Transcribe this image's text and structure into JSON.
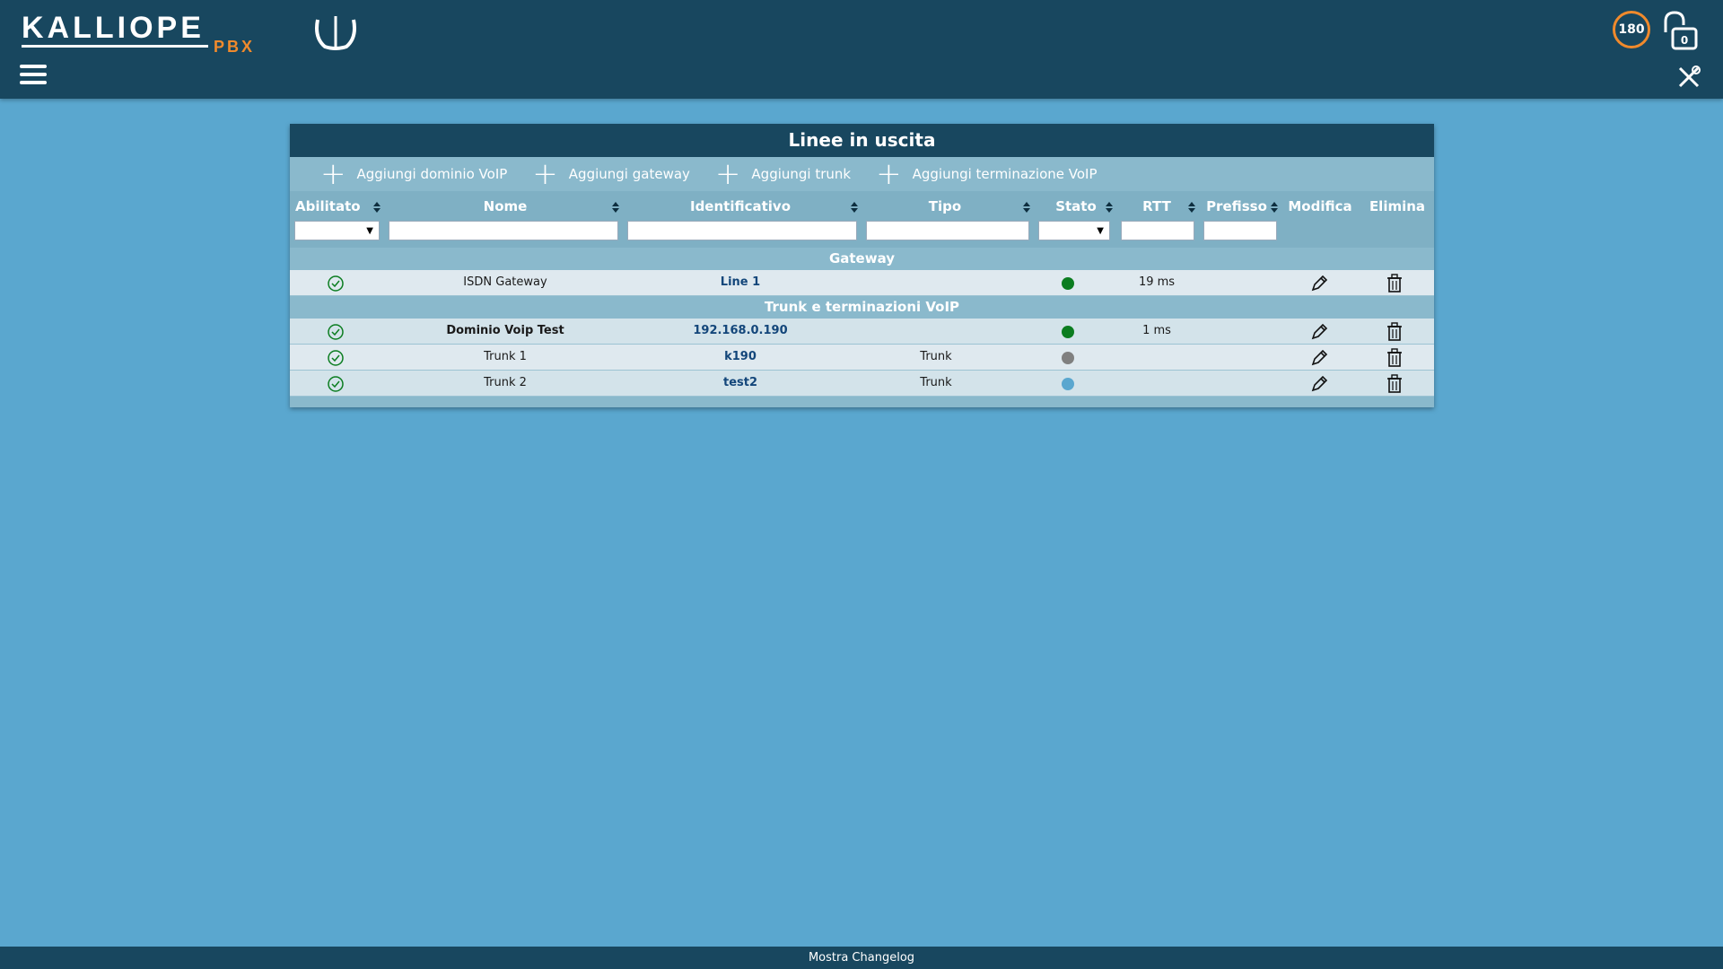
{
  "app": {
    "logo_text": "KALLIOPE",
    "logo_sub": "PBX",
    "timer": "180",
    "colors": {
      "header": "#18475f",
      "background": "#5aa7cf",
      "accent": "#f08a2c",
      "panel": "#8ab9cc"
    },
    "icons": [
      "hamburger-icon",
      "lock-icon",
      "tools-icon"
    ]
  },
  "panel": {
    "title": "Linee in uscita",
    "actions": [
      {
        "label": "Aggiungi dominio VoIP"
      },
      {
        "label": "Aggiungi gateway"
      },
      {
        "label": "Aggiungi trunk"
      },
      {
        "label": "Aggiungi terminazione VoIP"
      }
    ],
    "columns": [
      "Abilitato",
      "Nome",
      "Identificativo",
      "Tipo",
      "Stato",
      "RTT",
      "Prefisso",
      "Modifica",
      "Elimina"
    ],
    "groups": [
      {
        "name": "Gateway",
        "rows": [
          {
            "enabled": true,
            "nome": "ISDN Gateway",
            "identificativo": "Line 1",
            "tipo": "",
            "stato": "green",
            "rtt": "19 ms"
          }
        ]
      },
      {
        "name": "Trunk e terminazioni VoIP",
        "rows": [
          {
            "enabled": true,
            "nome": "Dominio Voip Test",
            "identificativo": "192.168.0.190",
            "tipo": "",
            "stato": "green",
            "rtt": "1 ms"
          },
          {
            "enabled": true,
            "nome": "Trunk 1",
            "identificativo": "k190",
            "tipo": "Trunk",
            "stato": "gray",
            "rtt": ""
          },
          {
            "enabled": true,
            "nome": "Trunk 2",
            "identificativo": "test2",
            "tipo": "Trunk",
            "stato": "blue",
            "rtt": ""
          }
        ]
      }
    ],
    "status_colors": {
      "green": "#0b7d20",
      "gray": "#808080",
      "blue": "#5aa7cf"
    }
  },
  "footer": {
    "label": "Mostra Changelog"
  }
}
